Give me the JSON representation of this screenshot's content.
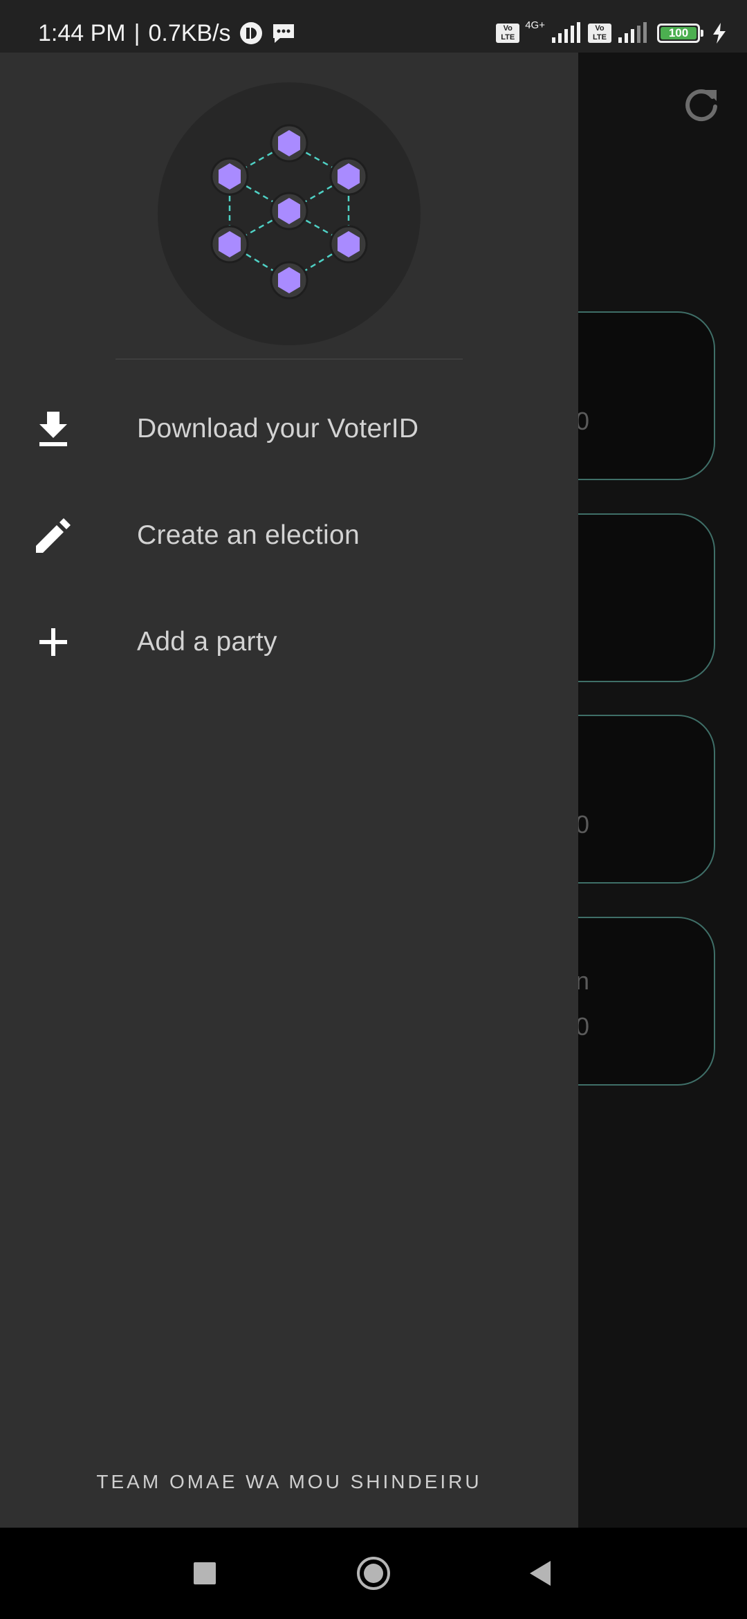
{
  "status_bar": {
    "time": "1:44 PM",
    "separator": "|",
    "speed": "0.7KB/s",
    "volte_1": "Vo LTE",
    "network_1": "4G+",
    "volte_2": "Vo LTE",
    "battery_level": "100",
    "icons": [
      "notification-app-icon",
      "message-icon",
      "signal-icon",
      "charging-icon"
    ]
  },
  "background": {
    "refresh_icon": "refresh-icon",
    "cards": [
      {
        "partial_text": "0"
      },
      {
        "partial_text": ""
      },
      {
        "partial_text": "0"
      },
      {
        "partial_text_top": "n",
        "partial_text": "0"
      }
    ]
  },
  "drawer": {
    "logo": "network-hexagon-logo",
    "menu": [
      {
        "icon": "download-icon",
        "label": "Download your VoterID"
      },
      {
        "icon": "pencil-icon",
        "label": "Create an election"
      },
      {
        "icon": "plus-icon",
        "label": "Add a party"
      }
    ],
    "footer": "TEAM OMAE WA MOU SHINDEIRU"
  },
  "nav_bar": {
    "buttons": [
      "recents-square-icon",
      "home-circle-icon",
      "back-triangle-icon"
    ]
  },
  "colors": {
    "drawer_bg": "#303030",
    "accent_teal": "#3f6f68",
    "hex_purple": "#a98bff",
    "battery_green": "#4caf50"
  }
}
